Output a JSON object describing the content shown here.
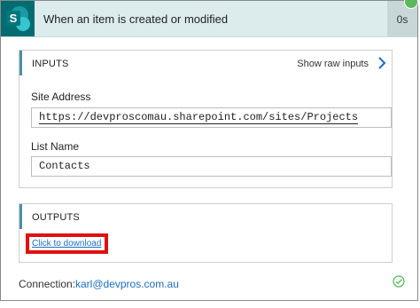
{
  "header": {
    "title": "When an item is created or modified",
    "duration": "0s",
    "app_icon": "sharepoint-icon",
    "status_icon": "success-check-icon"
  },
  "inputs": {
    "title": "INPUTS",
    "show_raw_label": "Show raw inputs",
    "fields": [
      {
        "label": "Site Address",
        "value": "https://devproscomau.sharepoint.com/sites/Projects"
      },
      {
        "label": "List Name",
        "value": "Contacts"
      }
    ]
  },
  "outputs": {
    "title": "OUTPUTS",
    "download_label": "Click to download"
  },
  "connection": {
    "label": "Connection:",
    "value": "karl@devpros.com.au"
  },
  "colors": {
    "header_bg": "#dcecec",
    "sharepoint_teal": "#036c70",
    "link_blue": "#1c6dbf",
    "highlight_red": "#e01010",
    "success_green": "#5cb85c"
  }
}
